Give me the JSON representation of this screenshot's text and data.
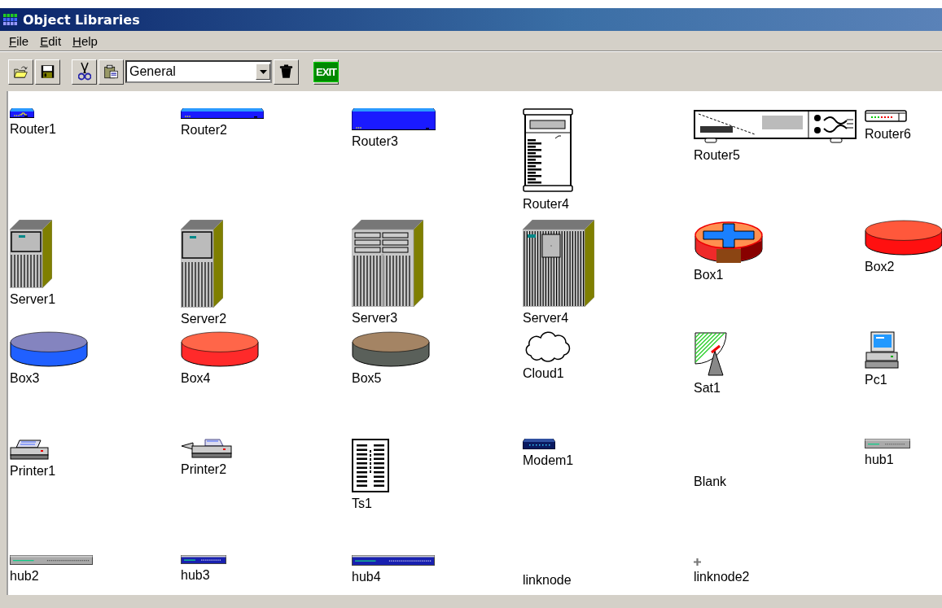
{
  "window": {
    "title": "Object Libraries"
  },
  "menu": [
    {
      "label": "File"
    },
    {
      "label": "Edit"
    },
    {
      "label": "Help"
    }
  ],
  "toolbar": [
    {
      "kind": "open"
    },
    {
      "kind": "save"
    },
    {
      "kind": "cut"
    },
    {
      "kind": "paste"
    },
    {
      "kind": "combo",
      "value": "General"
    },
    {
      "kind": "trash"
    },
    {
      "kind": "exit",
      "label": "EXIT"
    }
  ],
  "library": {
    "items": [
      {
        "label": "Router1",
        "kind": "router-small"
      },
      {
        "label": "Router2",
        "kind": "router-flat"
      },
      {
        "label": "Router3",
        "kind": "router-box"
      },
      {
        "label": "Router4",
        "kind": "router-tall"
      },
      {
        "label": "Router5",
        "kind": "router-rack"
      },
      {
        "label": "Router6",
        "kind": "router-mini"
      },
      {
        "label": "Server1",
        "kind": "server-small"
      },
      {
        "label": "Server2",
        "kind": "server-tower"
      },
      {
        "label": "Server3",
        "kind": "server-drawers"
      },
      {
        "label": "Server4",
        "kind": "server-cabinet"
      },
      {
        "label": "Box1",
        "kind": "router-cylinder"
      },
      {
        "label": "Box2",
        "kind": "disk",
        "color": "#ff1010"
      },
      {
        "label": "Box3",
        "kind": "disk",
        "color": "#2060ff"
      },
      {
        "label": "Box4",
        "kind": "disk",
        "color": "#ff2a2a"
      },
      {
        "label": "Box5",
        "kind": "disk",
        "color": "#5a605a"
      },
      {
        "label": "Cloud1",
        "kind": "cloud"
      },
      {
        "label": "Sat1",
        "kind": "satellite"
      },
      {
        "label": "Pc1",
        "kind": "pc"
      },
      {
        "label": "Printer1",
        "kind": "printer"
      },
      {
        "label": "Printer2",
        "kind": "printer-wide"
      },
      {
        "label": "Ts1",
        "kind": "terminal-server"
      },
      {
        "label": "Modem1",
        "kind": "modem"
      },
      {
        "label": "Blank",
        "kind": "blank"
      },
      {
        "label": "hub1",
        "kind": "hub"
      },
      {
        "label": "hub2",
        "kind": "hub-long"
      },
      {
        "label": "hub3",
        "kind": "switch"
      },
      {
        "label": "hub4",
        "kind": "switch-long"
      },
      {
        "label": "linknode",
        "kind": "node"
      },
      {
        "label": "linknode2",
        "kind": "node-plus"
      }
    ]
  }
}
